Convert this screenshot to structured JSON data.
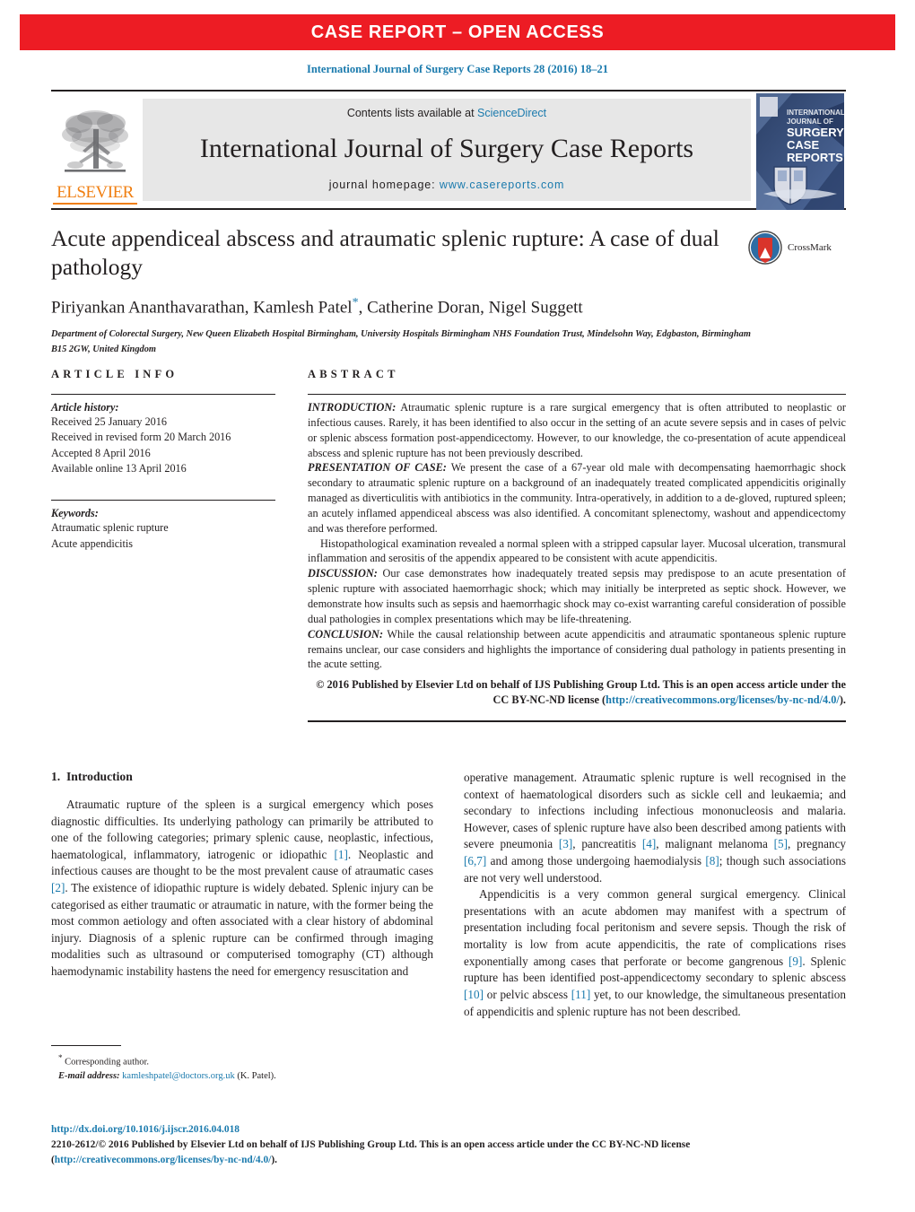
{
  "banner": {
    "text": "CASE REPORT – OPEN ACCESS"
  },
  "journal_ref": "International Journal of Surgery Case Reports 28 (2016) 18–21",
  "masthead": {
    "publisher_name": "ELSEVIER",
    "contents_prefix": "Contents lists available at ",
    "contents_link": "ScienceDirect",
    "journal_title": "International Journal of Surgery Case Reports",
    "homepage_prefix": "journal homepage: ",
    "homepage_link": "www.casereports.com",
    "cover": {
      "line1": "INTERNATIONAL",
      "line2": "JOURNAL OF",
      "line3": "SURGERY",
      "line4": "CASE",
      "line5": "REPORTS"
    }
  },
  "article": {
    "title": "Acute appendiceal abscess and atraumatic splenic rupture: A case of dual pathology",
    "authors_before_star": "Piriyankan Ananthavarathan, Kamlesh Patel",
    "author_star": "*",
    "authors_after_star": ", Catherine Doran, Nigel Suggett",
    "affiliation": "Department of Colorectal Surgery, New Queen Elizabeth Hospital Birmingham, University Hospitals Birmingham NHS Foundation Trust, Mindelsohn Way, Edgbaston, Birmingham B15 2GW, United Kingdom",
    "crossmark_label": "CrossMark"
  },
  "article_info": {
    "heading": "ARTICLE INFO",
    "history_label": "Article history:",
    "history": [
      "Received 25 January 2016",
      "Received in revised form 20 March 2016",
      "Accepted 8 April 2016",
      "Available online 13 April 2016"
    ],
    "keywords_label": "Keywords:",
    "keywords": [
      "Atraumatic splenic rupture",
      "Acute appendicitis"
    ]
  },
  "abstract": {
    "heading": "ABSTRACT",
    "sections": [
      {
        "lead": "INTRODUCTION:",
        "text": " Atraumatic splenic rupture is a rare surgical emergency that is often attributed to neoplastic or infectious causes. Rarely, it has been identified to also occur in the setting of an acute severe sepsis and in cases of pelvic or splenic abscess formation post-appendicectomy. However, to our knowledge, the co-presentation of acute appendiceal abscess and splenic rupture has not been previously described."
      },
      {
        "lead": "PRESENTATION OF CASE:",
        "text": " We present the case of a 67-year old male with decompensating haemorrhagic shock secondary to atraumatic splenic rupture on a background of an inadequately treated complicated appendicitis originally managed as diverticulitis with antibiotics in the community. Intra-operatively, in addition to a de-gloved, ruptured spleen; an acutely inflamed appendiceal abscess was also identified. A concomitant splenectomy, washout and appendicectomy and was therefore performed."
      },
      {
        "lead": "",
        "text": "Histopathological examination revealed a normal spleen with a stripped capsular layer. Mucosal ulceration, transmural inflammation and serositis of the appendix appeared to be consistent with acute appendicitis.",
        "indent": true
      },
      {
        "lead": "DISCUSSION:",
        "text": " Our case demonstrates how inadequately treated sepsis may predispose to an acute presentation of splenic rupture with associated haemorrhagic shock; which may initially be interpreted as septic shock. However, we demonstrate how insults such as sepsis and haemorrhagic shock may co-exist warranting careful consideration of possible dual pathologies in complex presentations which may be life-threatening."
      },
      {
        "lead": "CONCLUSION:",
        "text": " While the causal relationship between acute appendicitis and atraumatic spontaneous splenic rupture remains unclear, our case considers and highlights the importance of considering dual pathology in patients presenting in the acute setting."
      }
    ],
    "copyright_text": "© 2016 Published by Elsevier Ltd on behalf of IJS Publishing Group Ltd. This is an open access article under the CC BY-NC-ND license (",
    "copyright_link": "http://creativecommons.org/licenses/by-nc-nd/4.0/",
    "copyright_suffix": ")."
  },
  "body": {
    "section_number": "1.",
    "section_title": "Introduction",
    "left_paragraph_1": "Atraumatic rupture of the spleen is a surgical emergency which poses diagnostic difficulties. Its underlying pathology can primarily be attributed to one of the following categories; primary splenic cause, neoplastic, infectious, haematological, inflammatory, iatrogenic or idiopathic ",
    "ref_1": "[1]",
    "left_paragraph_1b": ". Neoplastic and infectious causes are thought to be the most prevalent cause of atraumatic cases ",
    "ref_2": "[2]",
    "left_paragraph_1c": ". The existence of idiopathic rupture is widely debated. Splenic injury can be categorised as either traumatic or atraumatic in nature, with the former being the most common aetiology and often associated with a clear history of abdominal injury. Diagnosis of a splenic rupture can be confirmed through imaging modalities such as ultrasound or computerised tomography (CT) although haemodynamic instability hastens the need for emergency resuscitation and",
    "right_paragraph_1": "operative management. Atraumatic splenic rupture is well recognised in the context of haematological disorders such as sickle cell and leukaemia; and secondary to infections including infectious mononucleosis and malaria. However, cases of splenic rupture have also been described among patients with severe pneumonia ",
    "ref_3": "[3]",
    "right_paragraph_1b": ", pancreatitis ",
    "ref_4": "[4]",
    "right_paragraph_1c": ", malignant melanoma ",
    "ref_5": "[5]",
    "right_paragraph_1d": ", pregnancy ",
    "ref_67": "[6,7]",
    "right_paragraph_1e": " and among those undergoing haemodialysis ",
    "ref_8": "[8]",
    "right_paragraph_1f": "; though such associations are not very well understood.",
    "right_paragraph_2": "Appendicitis is a very common general surgical emergency. Clinical presentations with an acute abdomen may manifest with a spectrum of presentation including focal peritonism and severe sepsis. Though the risk of mortality is low from acute appendicitis, the rate of complications rises exponentially among cases that perforate or become gangrenous ",
    "ref_9": "[9]",
    "right_paragraph_2b": ". Splenic rupture has been identified post-appendicectomy secondary to splenic abscess ",
    "ref_10": "[10]",
    "right_paragraph_2c": " or pelvic abscess ",
    "ref_11": "[11]",
    "right_paragraph_2d": " yet, to our knowledge, the simultaneous presentation of appendicitis and splenic rupture has not been described."
  },
  "footnote": {
    "star": "*",
    "corresponding": " Corresponding author.",
    "email_label": "E-mail address:",
    "email": "kamleshpatel@doctors.org.uk",
    "email_suffix": " (K. Patel)."
  },
  "bottom": {
    "doi": "http://dx.doi.org/10.1016/j.ijscr.2016.04.018",
    "issn_prefix": "2210-2612/© 2016 Published by Elsevier Ltd on behalf of IJS Publishing Group Ltd. This is an open access article under the CC BY-NC-ND license (",
    "issn_link1": "http://creativecommons.",
    "issn_link2": "org/licenses/by-nc-nd/4.0/",
    "issn_suffix": ")."
  },
  "colors": {
    "banner_red": "#ed1c24",
    "link_blue": "#1a7aad",
    "elsevier_orange": "#f07f12",
    "masthead_grey": "#e7e7e7",
    "text_black": "#231f20"
  }
}
